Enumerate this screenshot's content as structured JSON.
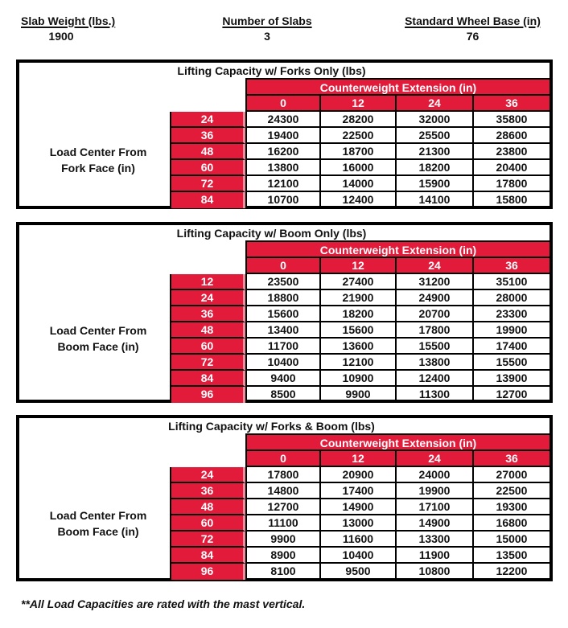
{
  "specs": {
    "slab_weight": {
      "label": "Slab Weight (lbs.)",
      "value": "1900"
    },
    "number_of_slabs": {
      "label": "Number of Slabs",
      "value": "3"
    },
    "wheel_base": {
      "label": "Standard Wheel Base (in)",
      "value": "76"
    }
  },
  "colors": {
    "header_red": "#e21b3b",
    "border": "#000000",
    "text": "#111111"
  },
  "tables": [
    {
      "title": "Lifting Capacity w/ Forks Only (lbs)",
      "side_label_line1": "Load Center From",
      "side_label_line2": "Fork Face (in)",
      "column_group_header": "Counterweight Extension (in)",
      "columns": [
        "0",
        "12",
        "24",
        "36"
      ],
      "rows": [
        {
          "load_center": "24",
          "values": [
            "24300",
            "28200",
            "32000",
            "35800"
          ]
        },
        {
          "load_center": "36",
          "values": [
            "19400",
            "22500",
            "25500",
            "28600"
          ]
        },
        {
          "load_center": "48",
          "values": [
            "16200",
            "18700",
            "21300",
            "23800"
          ]
        },
        {
          "load_center": "60",
          "values": [
            "13800",
            "16000",
            "18200",
            "20400"
          ]
        },
        {
          "load_center": "72",
          "values": [
            "12100",
            "14000",
            "15900",
            "17800"
          ]
        },
        {
          "load_center": "84",
          "values": [
            "10700",
            "12400",
            "14100",
            "15800"
          ]
        }
      ]
    },
    {
      "title": "Lifting Capacity w/ Boom Only (lbs)",
      "side_label_line1": "Load Center From",
      "side_label_line2": "Boom Face (in)",
      "column_group_header": "Counterweight Extension (in)",
      "columns": [
        "0",
        "12",
        "24",
        "36"
      ],
      "rows": [
        {
          "load_center": "12",
          "values": [
            "23500",
            "27400",
            "31200",
            "35100"
          ]
        },
        {
          "load_center": "24",
          "values": [
            "18800",
            "21900",
            "24900",
            "28000"
          ]
        },
        {
          "load_center": "36",
          "values": [
            "15600",
            "18200",
            "20700",
            "23300"
          ]
        },
        {
          "load_center": "48",
          "values": [
            "13400",
            "15600",
            "17800",
            "19900"
          ]
        },
        {
          "load_center": "60",
          "values": [
            "11700",
            "13600",
            "15500",
            "17400"
          ]
        },
        {
          "load_center": "72",
          "values": [
            "10400",
            "12100",
            "13800",
            "15500"
          ]
        },
        {
          "load_center": "84",
          "values": [
            "9400",
            "10900",
            "12400",
            "13900"
          ]
        },
        {
          "load_center": "96",
          "values": [
            "8500",
            "9900",
            "11300",
            "12700"
          ]
        }
      ]
    },
    {
      "title": "Lifting Capacity w/ Forks & Boom (lbs)",
      "side_label_line1": "Load Center From",
      "side_label_line2": "Boom Face (in)",
      "column_group_header": "Counterweight Extension (in)",
      "columns": [
        "0",
        "12",
        "24",
        "36"
      ],
      "rows": [
        {
          "load_center": "24",
          "values": [
            "17800",
            "20900",
            "24000",
            "27000"
          ]
        },
        {
          "load_center": "36",
          "values": [
            "14800",
            "17400",
            "19900",
            "22500"
          ]
        },
        {
          "load_center": "48",
          "values": [
            "12700",
            "14900",
            "17100",
            "19300"
          ]
        },
        {
          "load_center": "60",
          "values": [
            "11100",
            "13000",
            "14900",
            "16800"
          ]
        },
        {
          "load_center": "72",
          "values": [
            "9900",
            "11600",
            "13300",
            "15000"
          ]
        },
        {
          "load_center": "84",
          "values": [
            "8900",
            "10400",
            "11900",
            "13500"
          ]
        },
        {
          "load_center": "96",
          "values": [
            "8100",
            "9500",
            "10800",
            "12200"
          ]
        }
      ]
    }
  ],
  "footnote": "**All Load Capacities are rated with the mast vertical."
}
